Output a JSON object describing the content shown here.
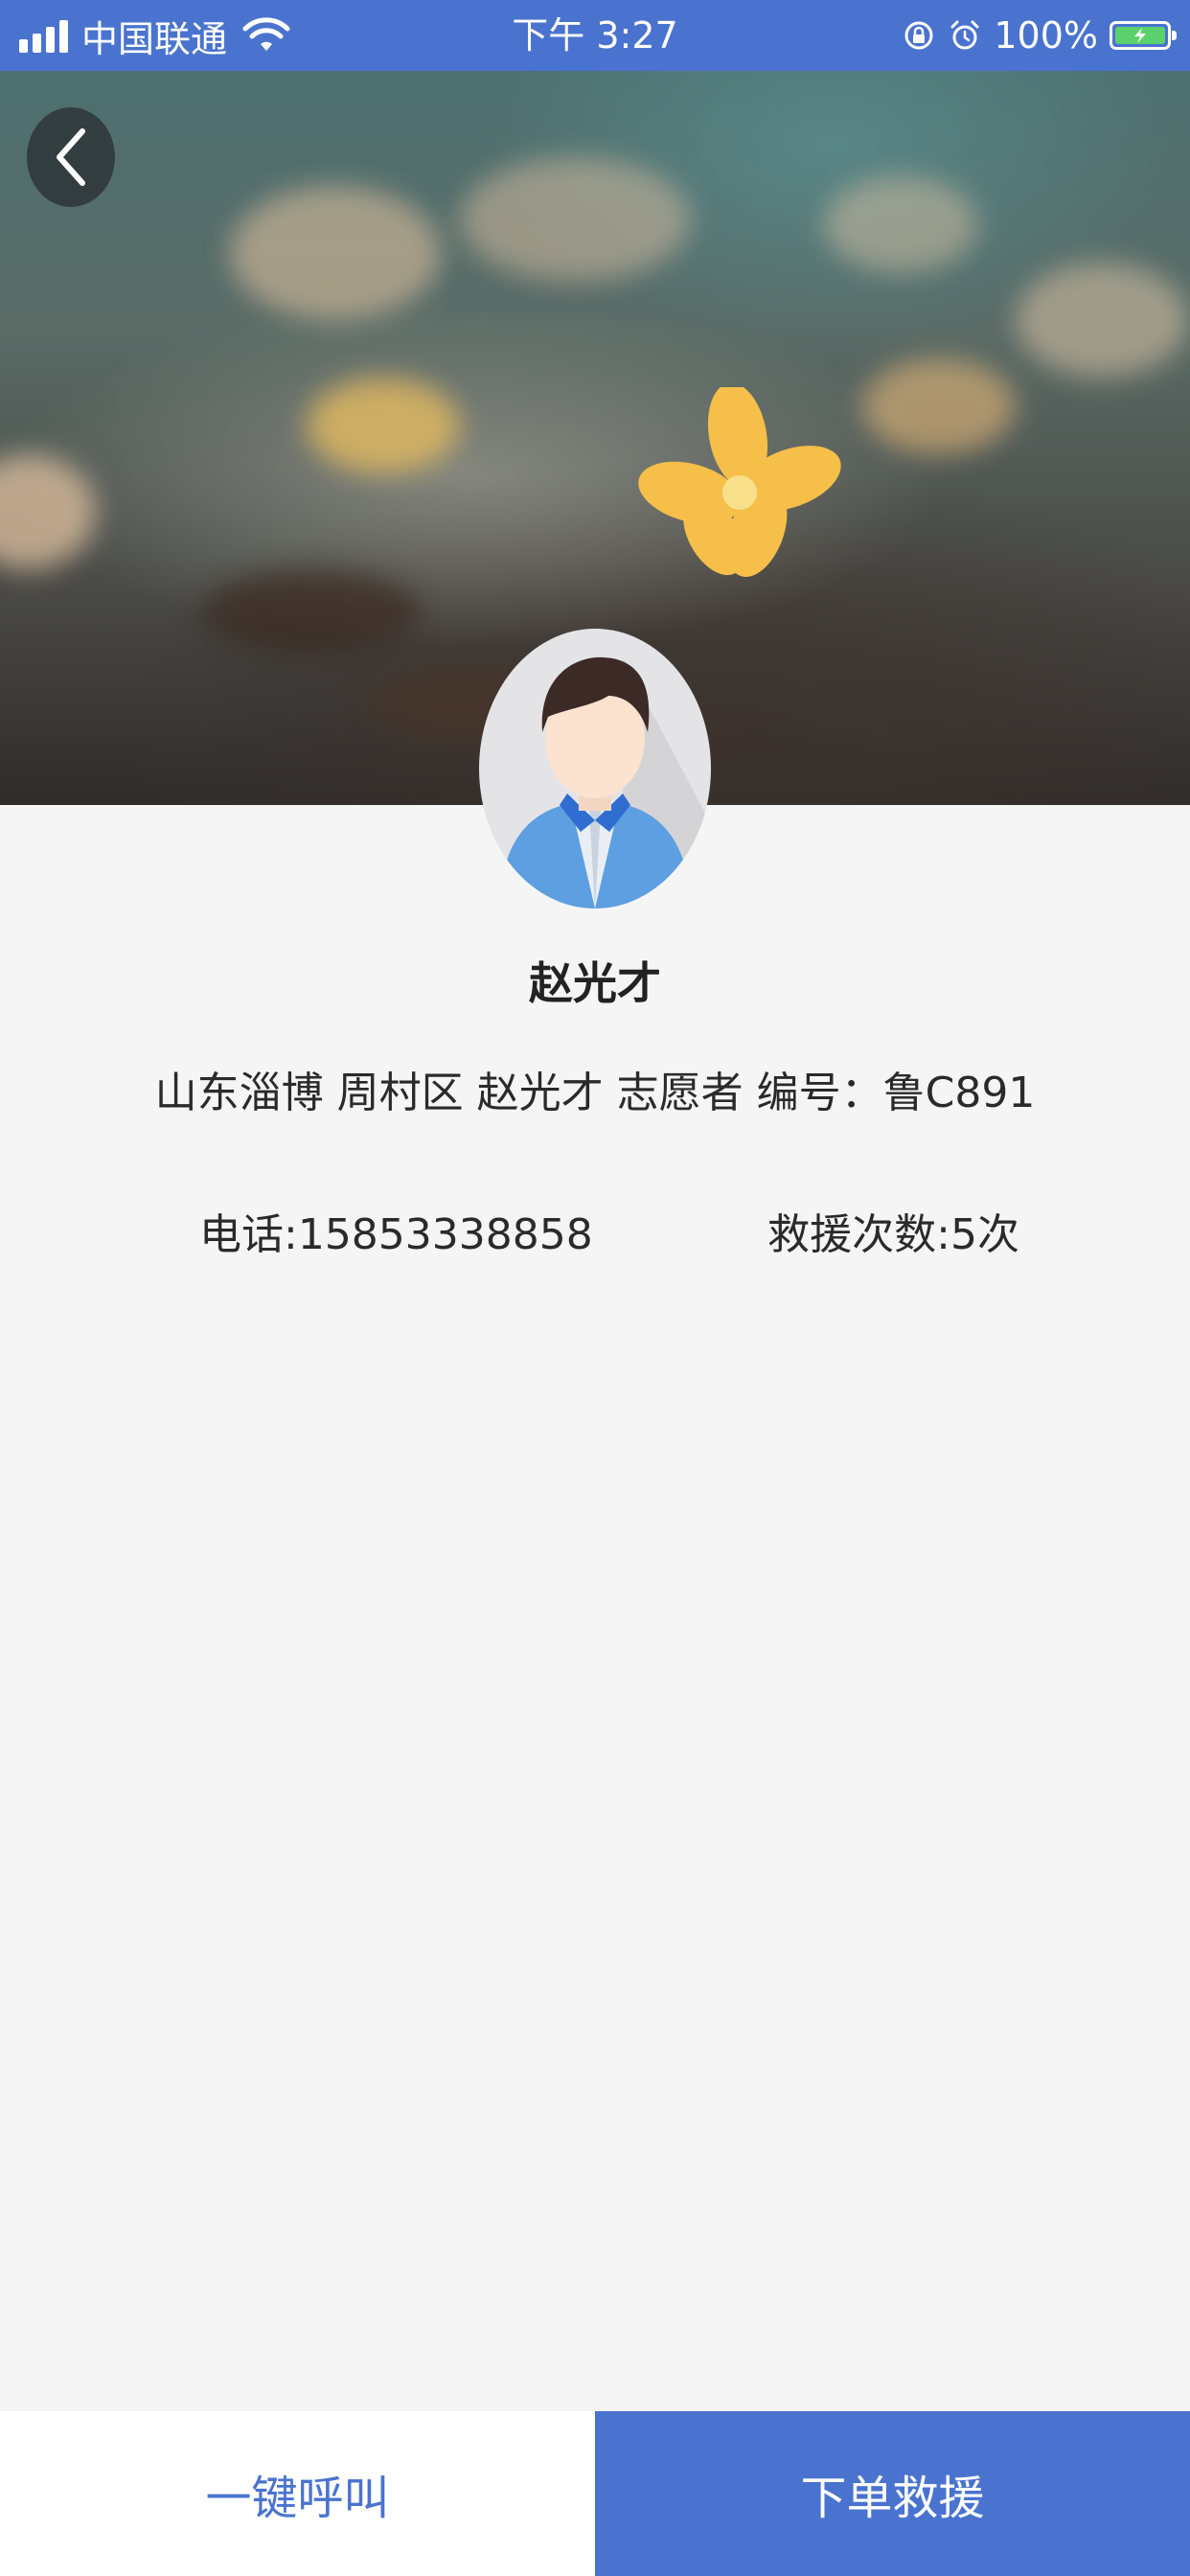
{
  "status_bar": {
    "carrier": "中国联通",
    "time": "下午 3:27",
    "battery": "100%",
    "icons": [
      "signal-icon",
      "wifi-icon",
      "orientation-lock-icon",
      "alarm-icon",
      "battery-charging-icon"
    ]
  },
  "hero": {
    "back_icon": "chevron-left-icon"
  },
  "profile": {
    "name": "赵光才",
    "description": "山东淄博 周村区 赵光才 志愿者 编号：鲁C891",
    "phone": "电话:15853338858",
    "rescue_count": "救援次数:5次"
  },
  "actions": {
    "call_label": "一键呼叫",
    "order_label": "下单救援"
  },
  "colors": {
    "primary": "#4a73cf",
    "background": "#f5f5f5"
  }
}
